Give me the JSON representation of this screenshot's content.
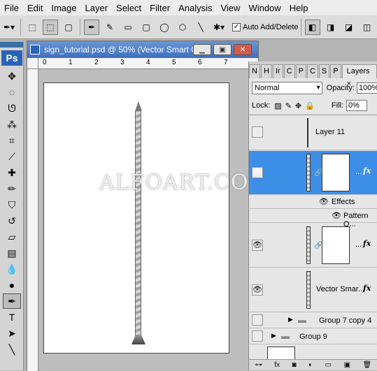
{
  "menu": {
    "items": [
      "File",
      "Edit",
      "Image",
      "Layer",
      "Select",
      "Filter",
      "Analysis",
      "View",
      "Window",
      "Help"
    ]
  },
  "options_bar": {
    "auto_add_delete_label": "Auto Add/Delete",
    "auto_add_delete_checked": true
  },
  "toolbox": {
    "logo": "Ps"
  },
  "document": {
    "title": "sign_tutorial.psd @ 50% (Vector Smart O...",
    "ruler_h": [
      "0",
      "1",
      "2",
      "3",
      "4",
      "5",
      "6",
      "7"
    ],
    "watermark": "ALFOART.COM"
  },
  "layers_panel": {
    "tabs": [
      "N",
      "H",
      "Ir",
      "C",
      "P",
      "C",
      "S",
      "P",
      "Layers"
    ],
    "active_tab": "Layers",
    "blend_mode": "Normal",
    "opacity_label": "Opacity:",
    "opacity_value": "100%",
    "lock_label": "Lock:",
    "fill_label": "Fill:",
    "fill_value": "0%",
    "layers": [
      {
        "name": "Layer 11"
      },
      {
        "name": "...",
        "fx": "fx"
      },
      {
        "name": "Effects"
      },
      {
        "name": "Pattern O..."
      },
      {
        "name": "...",
        "fx": "fx"
      },
      {
        "name": "Vector Smar...",
        "fx": "fx"
      },
      {
        "name": "Group 7 copy 4"
      },
      {
        "name": "Group 9"
      }
    ]
  }
}
